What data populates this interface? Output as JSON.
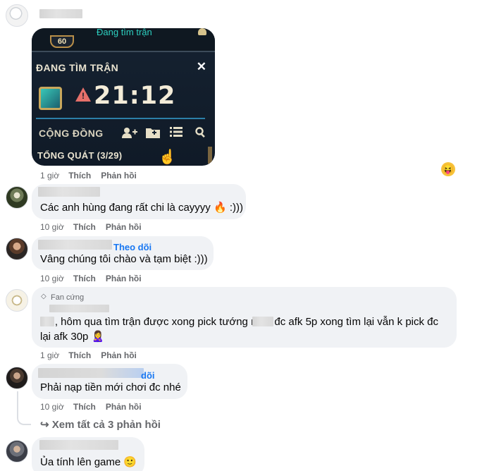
{
  "post": {
    "game_screenshot": {
      "level": "60",
      "top_status": "Đang tìm trận",
      "header": "ĐANG TÌM TRẬN",
      "close_glyph": "✕",
      "warn_glyph": "!",
      "timer": "21:12",
      "community_label": "CỘNG ĐỒNG",
      "summary_label": "TỔNG QUÁT (3/29)",
      "cursor_glyph": "☝",
      "icons": [
        "add-friend-icon",
        "add-folder-icon",
        "list-icon",
        "search-icon"
      ]
    },
    "actions": {
      "time": "1 giờ",
      "like": "Thích",
      "reply": "Phản hồi"
    },
    "reaction_emoji": "😝"
  },
  "comments": [
    {
      "text": "Các anh hùng đang rất chi là cayyyy 🔥 :)))",
      "actions": {
        "time": "10 giờ",
        "like": "Thích",
        "reply": "Phản hồi"
      }
    },
    {
      "follow": "Theo dõi",
      "text": "Vâng chúng tôi chào và tạm biệt :)))",
      "actions": {
        "time": "10 giờ",
        "like": "Thích",
        "reply": "Phản hồi"
      }
    },
    {
      "badge": "Fan cứng",
      "badge_icon": "◇",
      "text_line1": "hả , hôm qua tìm trận được xong pick tướng m     đc afk 5p xong tìm lại vẫn k pick đc",
      "text_line2": "lại afk 30p 🙎‍♀️",
      "actions": {
        "time": "1 giờ",
        "like": "Thích",
        "reply": "Phản hồi"
      }
    },
    {
      "follow_partial": "dõi",
      "text": "Phải nạp tiền mới chơi đc nhé",
      "actions": {
        "time": "10 giờ",
        "like": "Thích",
        "reply": "Phản hồi"
      }
    },
    {
      "text": "Ủa tính lên game 🙂"
    }
  ],
  "see_all_replies": "↪ Xem tất cả 3 phản hồi"
}
